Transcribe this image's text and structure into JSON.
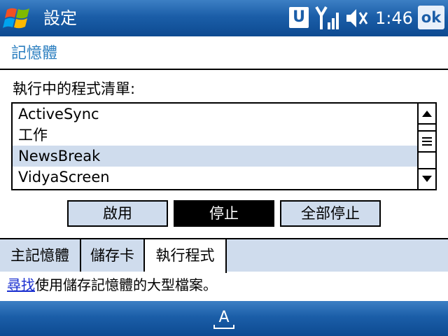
{
  "titlebar": {
    "title": "設定",
    "badge": "U",
    "clock": "1:46",
    "ok_label": "ok"
  },
  "page": {
    "title": "記憶體",
    "list_label": "執行中的程式清單:"
  },
  "programs": [
    {
      "name": "ActiveSync",
      "selected": false
    },
    {
      "name": "工作",
      "selected": false
    },
    {
      "name": "NewsBreak",
      "selected": true
    },
    {
      "name": "VidyaScreen",
      "selected": false
    }
  ],
  "buttons": {
    "activate": "啟用",
    "stop": "停止",
    "stop_all": "全部停止"
  },
  "tabs": [
    {
      "label": "主記憶體",
      "active": false
    },
    {
      "label": "儲存卡",
      "active": false
    },
    {
      "label": "執行程式",
      "active": true
    }
  ],
  "hint": {
    "link": "尋找",
    "text": "使用儲存記憶體的大型檔案。"
  },
  "bottombar": {
    "sip_letter": "A"
  },
  "colors": {
    "titlebar": "#1b5ea8",
    "selection": "#cfdced",
    "accent_text": "#2c7fc0"
  }
}
